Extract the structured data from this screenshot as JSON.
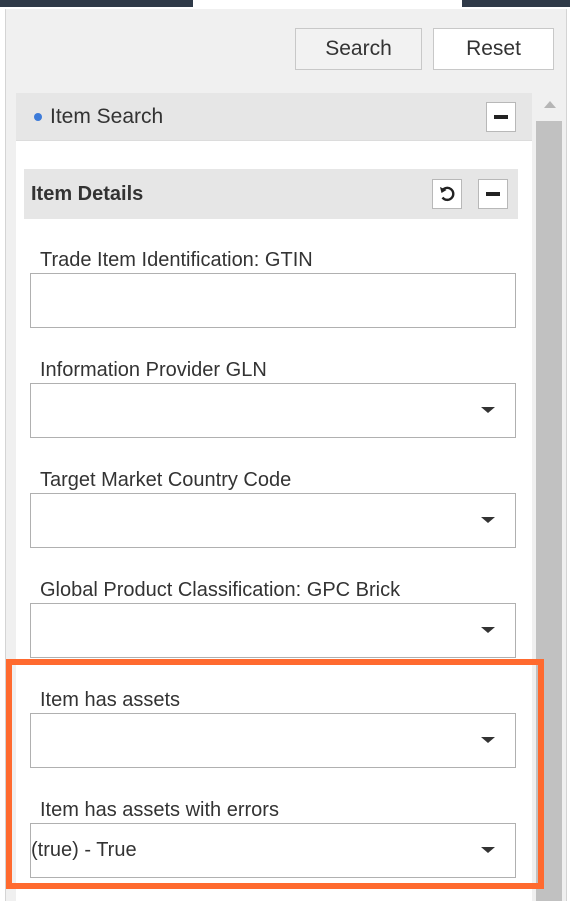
{
  "toolbar": {
    "search_label": "Search",
    "reset_label": "Reset"
  },
  "section": {
    "title": "Item Search"
  },
  "item_details": {
    "title": "Item Details"
  },
  "fields": [
    {
      "label": "Trade Item Identification: GTIN",
      "type": "text",
      "value": ""
    },
    {
      "label": "Information Provider GLN",
      "type": "select",
      "value": ""
    },
    {
      "label": "Target Market Country Code",
      "type": "select",
      "value": ""
    },
    {
      "label": "Global Product Classification: GPC Brick",
      "type": "select",
      "value": ""
    },
    {
      "label": "Item has assets",
      "type": "select",
      "value": ""
    },
    {
      "label": "Item has assets with errors",
      "type": "select",
      "value": "(true) - True"
    }
  ],
  "colors": {
    "highlight": "#ff6a2f",
    "bullet": "#3d7bd9",
    "panel": "#f0f0f0"
  },
  "icons": [
    "minus-icon",
    "reset-icon",
    "caret-down-icon",
    "bullet-icon"
  ]
}
